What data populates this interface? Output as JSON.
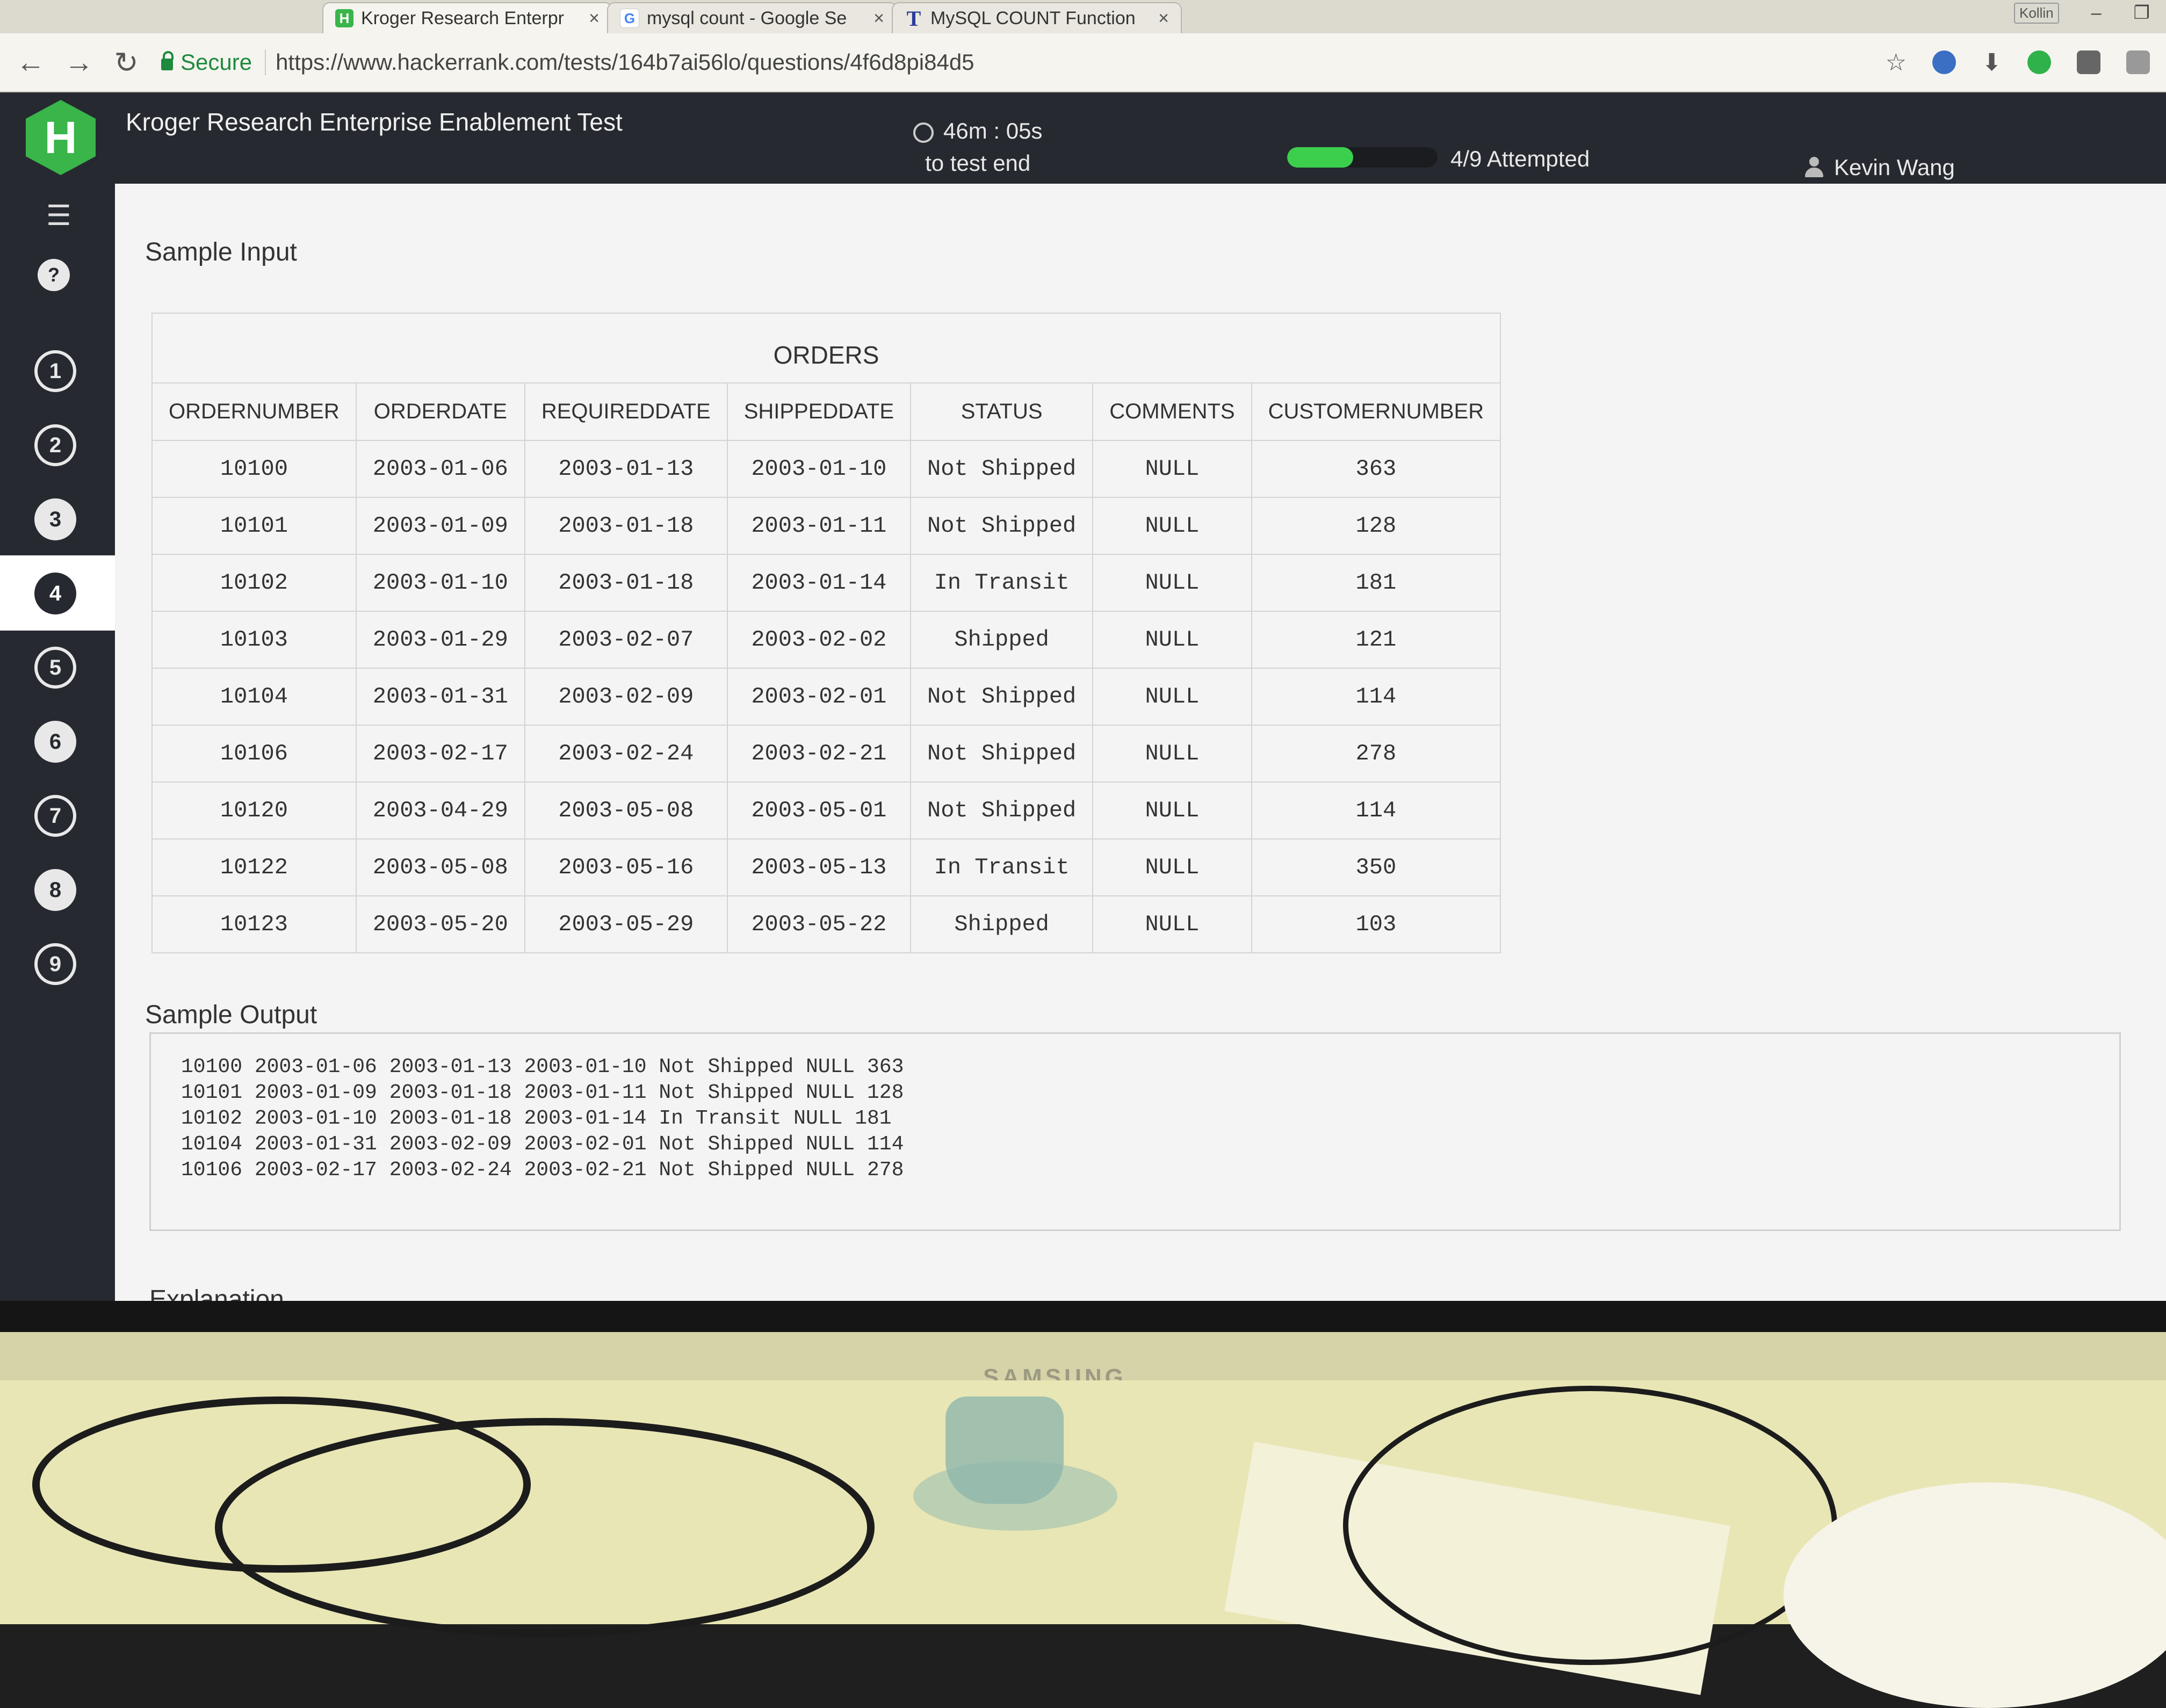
{
  "browser": {
    "tabs": [
      {
        "title": "Kroger Research Enterpr",
        "favicon": "hackerrank-icon",
        "close": "×"
      },
      {
        "title": "mysql count - Google Se",
        "favicon": "google-icon",
        "close": "×"
      },
      {
        "title": "MySQL COUNT Function",
        "favicon": "t-icon",
        "close": "×"
      }
    ],
    "window_user": "Kollin",
    "secure_label": "Secure",
    "url": "https://www.hackerrank.com/tests/164b7ai56lo/questions/4f6d8pi84d5"
  },
  "header": {
    "logo": "H",
    "test_title": "Kroger Research Enterprise Enablement Test",
    "timer": "46m : 05s",
    "timer_sub": "to test end",
    "attempted_text": "4/9 Attempted",
    "progress_fraction": 0.44,
    "user_name": "Kevin Wang"
  },
  "sidebar": {
    "questions": [
      "1",
      "2",
      "3",
      "4",
      "5",
      "6",
      "7",
      "8",
      "9"
    ],
    "active_question": "4"
  },
  "content": {
    "sample_input_title": "Sample Input",
    "table": {
      "caption": "ORDERS",
      "columns": [
        "ORDERNUMBER",
        "ORDERDATE",
        "REQUIREDDATE",
        "SHIPPEDDATE",
        "STATUS",
        "COMMENTS",
        "CUSTOMERNUMBER"
      ],
      "rows": [
        [
          "10100",
          "2003-01-06",
          "2003-01-13",
          "2003-01-10",
          "Not Shipped",
          "NULL",
          "363"
        ],
        [
          "10101",
          "2003-01-09",
          "2003-01-18",
          "2003-01-11",
          "Not Shipped",
          "NULL",
          "128"
        ],
        [
          "10102",
          "2003-01-10",
          "2003-01-18",
          "2003-01-14",
          "In Transit",
          "NULL",
          "181"
        ],
        [
          "10103",
          "2003-01-29",
          "2003-02-07",
          "2003-02-02",
          "Shipped",
          "NULL",
          "121"
        ],
        [
          "10104",
          "2003-01-31",
          "2003-02-09",
          "2003-02-01",
          "Not Shipped",
          "NULL",
          "114"
        ],
        [
          "10106",
          "2003-02-17",
          "2003-02-24",
          "2003-02-21",
          "Not Shipped",
          "NULL",
          "278"
        ],
        [
          "10120",
          "2003-04-29",
          "2003-05-08",
          "2003-05-01",
          "Not Shipped",
          "NULL",
          "114"
        ],
        [
          "10122",
          "2003-05-08",
          "2003-05-16",
          "2003-05-13",
          "In Transit",
          "NULL",
          "350"
        ],
        [
          "10123",
          "2003-05-20",
          "2003-05-29",
          "2003-05-22",
          "Shipped",
          "NULL",
          "103"
        ]
      ]
    },
    "sample_output_title": "Sample Output",
    "output_lines": [
      "10100 2003-01-06 2003-01-13 2003-01-10 Not Shipped NULL 363",
      "10101 2003-01-09 2003-01-18 2003-01-11 Not Shipped NULL 128",
      "10102 2003-01-10 2003-01-18 2003-01-14 In Transit NULL 181",
      "10104 2003-01-31 2003-02-09 2003-02-01 Not Shipped NULL 114",
      "10106 2003-02-17 2003-02-24 2003-02-21 Not Shipped NULL 278"
    ],
    "explanation_title": "Explanation"
  },
  "monitor": {
    "brand": "SAMSUNG"
  },
  "colors": {
    "accent": "#39b54a",
    "header_bg": "#262a30",
    "progress": "#3ccf4e"
  }
}
